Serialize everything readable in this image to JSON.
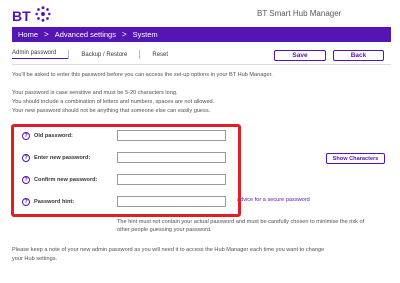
{
  "header": {
    "logo_text": "BT",
    "app_title": "BT Smart Hub Manager"
  },
  "breadcrumb": {
    "items": [
      "Home",
      "Advanced settings",
      "System"
    ],
    "separator": ">"
  },
  "subnav": {
    "tabs": [
      "Admin password",
      "Backup / Restore",
      "Reset"
    ],
    "active": "Admin password"
  },
  "toolbar": {
    "save_label": "Save",
    "back_label": "Back"
  },
  "intro": {
    "line1": "You'll be asked to enter this password before you can access the set-up options in your BT Hub Manager.",
    "line2": "Your password is case sensitive and must be 5-20 characters long.",
    "line3": "You should include a combination of letters and numbers, spaces are not allowed.",
    "line4": "Your new password should not be anything that someone else can easily guess."
  },
  "form": {
    "old_password_label": "Old password:",
    "new_password_label": "Enter new password:",
    "confirm_password_label": "Confirm new password:",
    "hint_label": "Password hint:",
    "old_password_value": "",
    "new_password_value": "",
    "confirm_password_value": "",
    "hint_value": "",
    "show_characters_label": "Show Characters",
    "advice_link": "advice for a secure password",
    "help_glyph": "?"
  },
  "hint_note": {
    "line1": "The hint must not contain your actual password and must be carefully chosen to minimise the risk of",
    "line2": "other people guessing your password."
  },
  "footer_note": {
    "line1": "Please keep a note of your new admin password as you will need it to access the Hub Manager each time you want to change",
    "line2": "your Hub settings."
  },
  "colors": {
    "brand": "#5514b4",
    "highlight": "#e01e25"
  },
  "icons": {
    "help": "question-circle-icon",
    "logo": "bt-globe-logo"
  }
}
